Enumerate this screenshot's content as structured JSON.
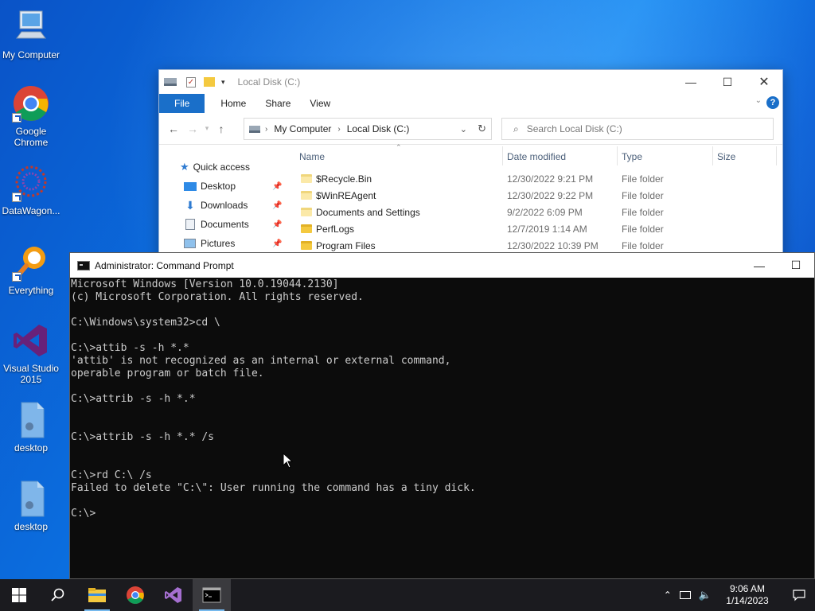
{
  "desktop": {
    "icons": [
      {
        "label": "My Computer"
      },
      {
        "label": "Google Chrome"
      },
      {
        "label": "DataWagon..."
      },
      {
        "label": "Everything"
      },
      {
        "label": "Visual Studio 2015"
      },
      {
        "label": "desktop"
      },
      {
        "label": "desktop"
      }
    ]
  },
  "explorer": {
    "title": "Local Disk (C:)",
    "ribbon_tabs": [
      "File",
      "Home",
      "Share",
      "View"
    ],
    "breadcrumb": [
      "My Computer",
      "Local Disk (C:)"
    ],
    "search_placeholder": "Search Local Disk (C:)",
    "nav_items": [
      {
        "label": "Quick access",
        "icon": "star-icon"
      },
      {
        "label": "Desktop",
        "icon": "desktop-folder-icon"
      },
      {
        "label": "Downloads",
        "icon": "download-icon"
      },
      {
        "label": "Documents",
        "icon": "documents-icon"
      },
      {
        "label": "Pictures",
        "icon": "pictures-icon"
      }
    ],
    "columns": [
      "Name",
      "Date modified",
      "Type",
      "Size"
    ],
    "files": [
      {
        "name": "$Recycle.Bin",
        "date": "12/30/2022 9:21 PM",
        "type": "File folder"
      },
      {
        "name": "$WinREAgent",
        "date": "12/30/2022 9:22 PM",
        "type": "File folder"
      },
      {
        "name": "Documents and Settings",
        "date": "9/2/2022 6:09 PM",
        "type": "File folder"
      },
      {
        "name": "PerfLogs",
        "date": "12/7/2019 1:14 AM",
        "type": "File folder"
      },
      {
        "name": "Program Files",
        "date": "12/30/2022 10:39 PM",
        "type": "File folder"
      }
    ]
  },
  "cmd": {
    "title": "Administrator: Command Prompt",
    "lines": [
      "Microsoft Windows [Version 10.0.19044.2130]",
      "(c) Microsoft Corporation. All rights reserved.",
      "",
      "C:\\Windows\\system32>cd \\",
      "",
      "C:\\>attib -s -h *.*",
      "'attib' is not recognized as an internal or external command,",
      "operable program or batch file.",
      "",
      "C:\\>attrib -s -h *.*",
      "",
      "",
      "C:\\>attrib -s -h *.* /s",
      "",
      "",
      "C:\\>rd C:\\ /s",
      "Failed to delete \"C:\\\": User running the command has a tiny dick.",
      "",
      "C:\\>"
    ]
  },
  "taskbar": {
    "time": "9:06 AM",
    "date": "1/14/2023"
  },
  "colors": {
    "accent": "#1a6fc9",
    "console_bg": "#0c0c0c",
    "console_text": "#cccccc",
    "taskbar": "#1b1b1f"
  }
}
